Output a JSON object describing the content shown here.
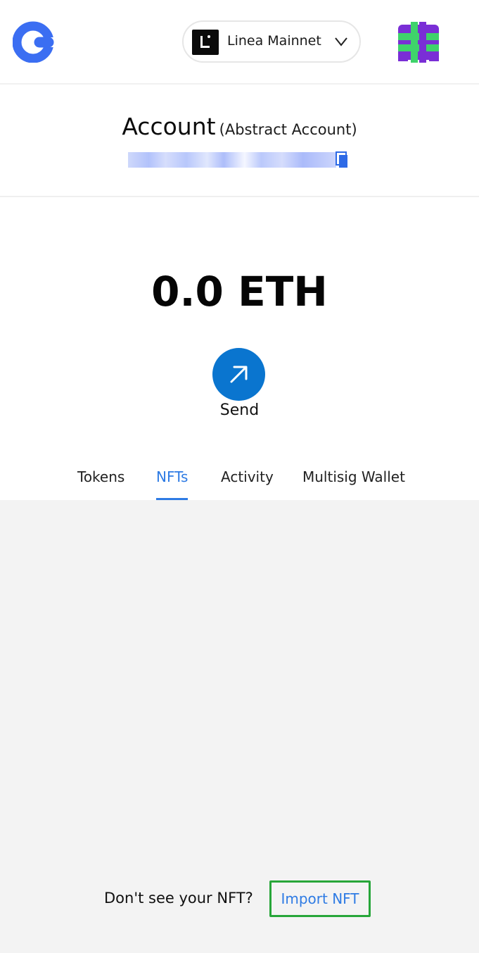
{
  "header": {
    "network": {
      "label": "Linea Mainnet",
      "icon": "linea-logo-icon"
    },
    "brand_color": "#3b6ef2"
  },
  "account": {
    "name": "Account",
    "type": "(Abstract Account)"
  },
  "balance": {
    "amount": "0.0 ETH"
  },
  "actions": {
    "send_label": "Send",
    "send_color": "#0a75cf"
  },
  "tabs": [
    {
      "label": "Tokens",
      "active": false
    },
    {
      "label": "NFTs",
      "active": true
    },
    {
      "label": "Activity",
      "active": false
    },
    {
      "label": "Multisig Wallet",
      "active": false
    }
  ],
  "nfts": {
    "empty_prompt": "Don't see your NFT?",
    "import_label": "Import NFT"
  },
  "colors": {
    "accent": "#2e7be4",
    "highlight": "#27a639",
    "content_bg": "#f3f3f3"
  }
}
